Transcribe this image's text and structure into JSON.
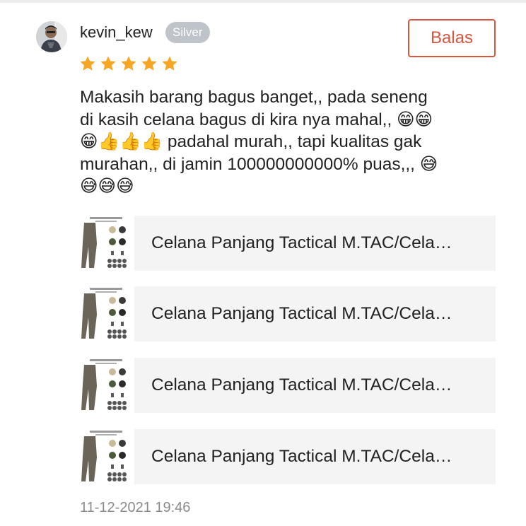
{
  "review": {
    "username": "kevin_kew",
    "badge": "Silver",
    "reply_label": "Balas",
    "rating": 5,
    "rating_max": 5,
    "text": "Makasih barang bagus banget,, pada seneng\ndi kasih celana bagus di kira nya mahal,, 😁😁\n😁👍👍👍 padahal murah,, tapi kualitas gak\nmurahan,, di jamin 100000000000% puas,,, 😅\n😅😅😅",
    "timestamp": "11-12-2021 19:46"
  },
  "products": [
    {
      "name": "Celana Panjang Tactical M.TAC/Cela…"
    },
    {
      "name": "Celana Panjang Tactical M.TAC/Cela…"
    },
    {
      "name": "Celana Panjang Tactical M.TAC/Cela…"
    },
    {
      "name": "Celana Panjang Tactical M.TAC/Cela…"
    }
  ],
  "colors": {
    "accent": "#d8563f",
    "star": "#f6a623",
    "badge_bg": "#bfc3ca",
    "product_bg": "#f4f4f4",
    "timestamp": "#8a8a8a"
  },
  "icons": {
    "star": "star-icon",
    "avatar": "avatar",
    "product_thumbnail": "product-thumbnail"
  }
}
